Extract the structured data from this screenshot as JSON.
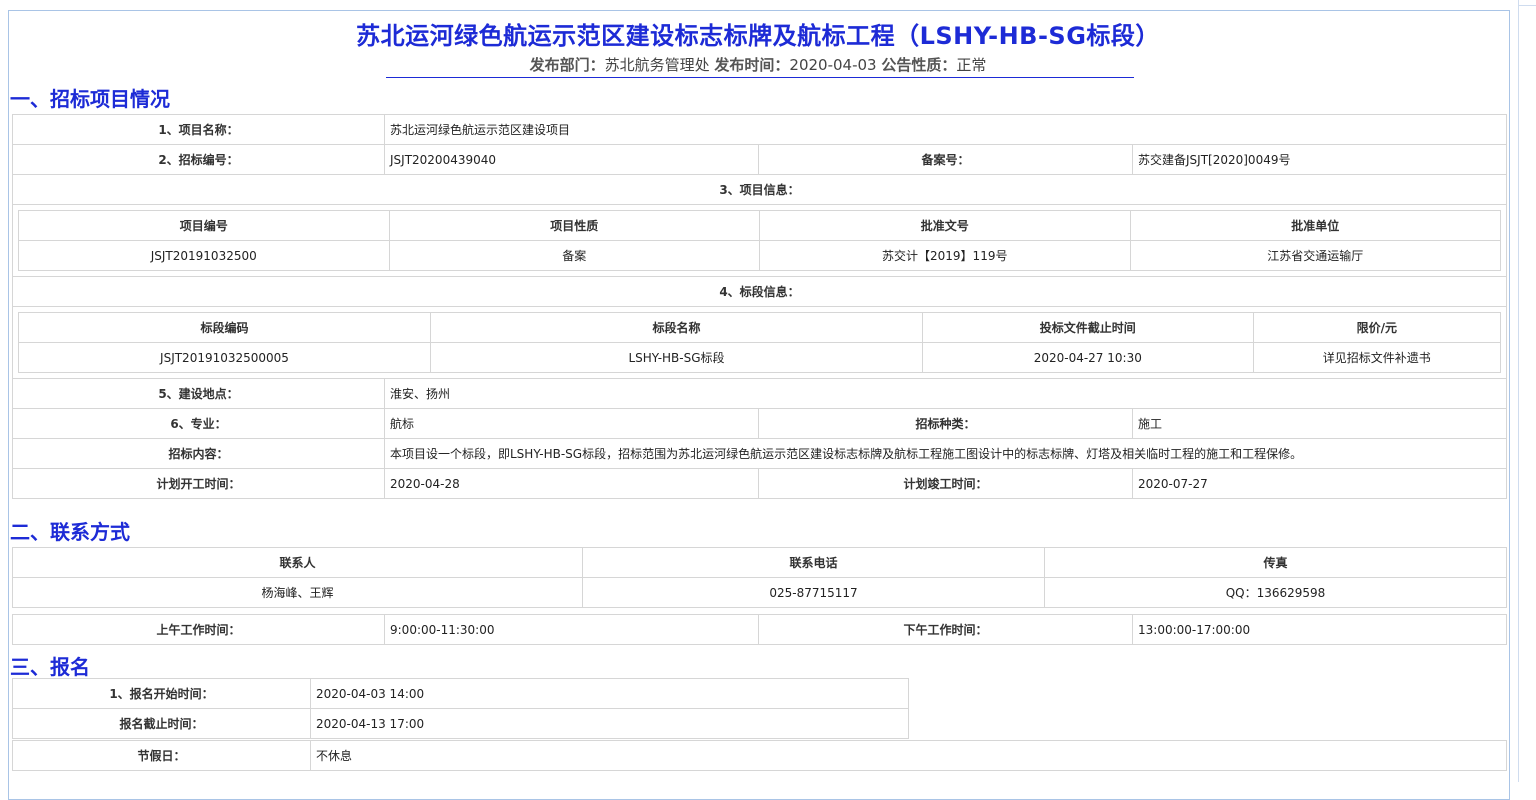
{
  "header": {
    "title": "苏北运河绿色航运示范区建设标志标牌及航标工程（LSHY-HB-SG标段）",
    "dept_label": "发布部门：",
    "dept": "苏北航务管理处",
    "date_label": "发布时间：",
    "date": "2020-04-03",
    "nature_label": "公告性质：",
    "nature": "正常"
  },
  "section1": {
    "heading": "一、招标项目情况",
    "project_name_label": "1、项目名称：",
    "project_name": "苏北运河绿色航运示范区建设项目",
    "bid_no_label": "2、招标编号：",
    "bid_no": "JSJT20200439040",
    "record_no_label": "备案号：",
    "record_no": "苏交建备JSJT[2020]0049号",
    "project_info_label": "3、项目信息：",
    "project_info": {
      "headers": [
        "项目编号",
        "项目性质",
        "批准文号",
        "批准单位"
      ],
      "row": [
        "JSJT20191032500",
        "备案",
        "苏交计【2019】119号",
        "江苏省交通运输厅"
      ]
    },
    "section_info_label": "4、标段信息：",
    "section_info": {
      "headers": [
        "标段编码",
        "标段名称",
        "投标文件截止时间",
        "限价/元"
      ],
      "row": [
        "JSJT20191032500005",
        "LSHY-HB-SG标段",
        "2020-04-27 10:30",
        "详见招标文件补遗书"
      ]
    },
    "location_label": "5、建设地点：",
    "location": "淮安、扬州",
    "major_label": "6、专业：",
    "major": "航标",
    "bid_type_label": "招标种类：",
    "bid_type": "施工",
    "content_label": "招标内容：",
    "content": "本项目设一个标段，即LSHY-HB-SG标段，招标范围为苏北运河绿色航运示范区建设标志标牌及航标工程施工图设计中的标志标牌、灯塔及相关临时工程的施工和工程保修。",
    "start_label": "计划开工时间：",
    "start": "2020-04-28",
    "end_label": "计划竣工时间：",
    "end": "2020-07-27"
  },
  "section2": {
    "heading": "二、联系方式",
    "headers": [
      "联系人",
      "联系电话",
      "传真"
    ],
    "row": [
      "杨海峰、王辉",
      "025-87715117",
      "QQ：136629598"
    ],
    "am_label": "上午工作时间：",
    "am": "9:00:00-11:30:00",
    "pm_label": "下午工作时间：",
    "pm": "13:00:00-17:00:00"
  },
  "section3": {
    "heading": "三、报名",
    "reg_start_label": "1、报名开始时间：",
    "reg_start": "2020-04-03 14:00",
    "reg_end_label": "报名截止时间：",
    "reg_end": "2020-04-13 17:00",
    "holiday_label": "节假日：",
    "holiday": "不休息"
  }
}
